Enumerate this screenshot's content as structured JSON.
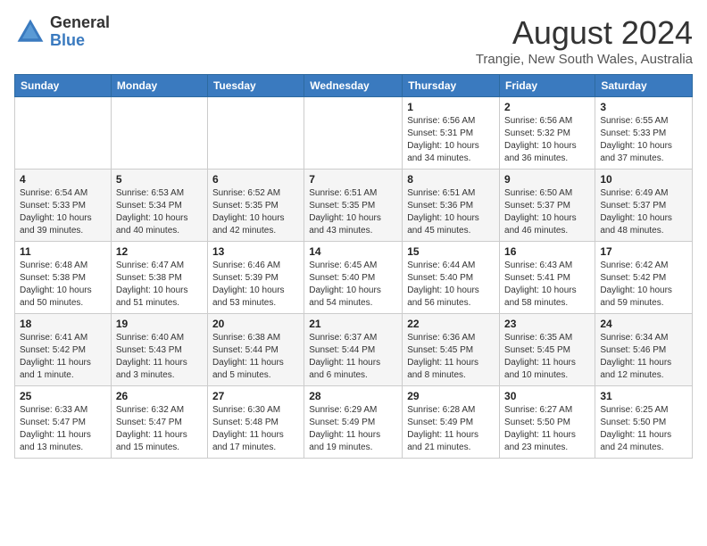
{
  "header": {
    "logo_general": "General",
    "logo_blue": "Blue",
    "main_title": "August 2024",
    "subtitle": "Trangie, New South Wales, Australia"
  },
  "calendar": {
    "weekdays": [
      "Sunday",
      "Monday",
      "Tuesday",
      "Wednesday",
      "Thursday",
      "Friday",
      "Saturday"
    ],
    "weeks": [
      [
        {
          "day": "",
          "info": ""
        },
        {
          "day": "",
          "info": ""
        },
        {
          "day": "",
          "info": ""
        },
        {
          "day": "",
          "info": ""
        },
        {
          "day": "1",
          "info": "Sunrise: 6:56 AM\nSunset: 5:31 PM\nDaylight: 10 hours\nand 34 minutes."
        },
        {
          "day": "2",
          "info": "Sunrise: 6:56 AM\nSunset: 5:32 PM\nDaylight: 10 hours\nand 36 minutes."
        },
        {
          "day": "3",
          "info": "Sunrise: 6:55 AM\nSunset: 5:33 PM\nDaylight: 10 hours\nand 37 minutes."
        }
      ],
      [
        {
          "day": "4",
          "info": "Sunrise: 6:54 AM\nSunset: 5:33 PM\nDaylight: 10 hours\nand 39 minutes."
        },
        {
          "day": "5",
          "info": "Sunrise: 6:53 AM\nSunset: 5:34 PM\nDaylight: 10 hours\nand 40 minutes."
        },
        {
          "day": "6",
          "info": "Sunrise: 6:52 AM\nSunset: 5:35 PM\nDaylight: 10 hours\nand 42 minutes."
        },
        {
          "day": "7",
          "info": "Sunrise: 6:51 AM\nSunset: 5:35 PM\nDaylight: 10 hours\nand 43 minutes."
        },
        {
          "day": "8",
          "info": "Sunrise: 6:51 AM\nSunset: 5:36 PM\nDaylight: 10 hours\nand 45 minutes."
        },
        {
          "day": "9",
          "info": "Sunrise: 6:50 AM\nSunset: 5:37 PM\nDaylight: 10 hours\nand 46 minutes."
        },
        {
          "day": "10",
          "info": "Sunrise: 6:49 AM\nSunset: 5:37 PM\nDaylight: 10 hours\nand 48 minutes."
        }
      ],
      [
        {
          "day": "11",
          "info": "Sunrise: 6:48 AM\nSunset: 5:38 PM\nDaylight: 10 hours\nand 50 minutes."
        },
        {
          "day": "12",
          "info": "Sunrise: 6:47 AM\nSunset: 5:38 PM\nDaylight: 10 hours\nand 51 minutes."
        },
        {
          "day": "13",
          "info": "Sunrise: 6:46 AM\nSunset: 5:39 PM\nDaylight: 10 hours\nand 53 minutes."
        },
        {
          "day": "14",
          "info": "Sunrise: 6:45 AM\nSunset: 5:40 PM\nDaylight: 10 hours\nand 54 minutes."
        },
        {
          "day": "15",
          "info": "Sunrise: 6:44 AM\nSunset: 5:40 PM\nDaylight: 10 hours\nand 56 minutes."
        },
        {
          "day": "16",
          "info": "Sunrise: 6:43 AM\nSunset: 5:41 PM\nDaylight: 10 hours\nand 58 minutes."
        },
        {
          "day": "17",
          "info": "Sunrise: 6:42 AM\nSunset: 5:42 PM\nDaylight: 10 hours\nand 59 minutes."
        }
      ],
      [
        {
          "day": "18",
          "info": "Sunrise: 6:41 AM\nSunset: 5:42 PM\nDaylight: 11 hours\nand 1 minute."
        },
        {
          "day": "19",
          "info": "Sunrise: 6:40 AM\nSunset: 5:43 PM\nDaylight: 11 hours\nand 3 minutes."
        },
        {
          "day": "20",
          "info": "Sunrise: 6:38 AM\nSunset: 5:44 PM\nDaylight: 11 hours\nand 5 minutes."
        },
        {
          "day": "21",
          "info": "Sunrise: 6:37 AM\nSunset: 5:44 PM\nDaylight: 11 hours\nand 6 minutes."
        },
        {
          "day": "22",
          "info": "Sunrise: 6:36 AM\nSunset: 5:45 PM\nDaylight: 11 hours\nand 8 minutes."
        },
        {
          "day": "23",
          "info": "Sunrise: 6:35 AM\nSunset: 5:45 PM\nDaylight: 11 hours\nand 10 minutes."
        },
        {
          "day": "24",
          "info": "Sunrise: 6:34 AM\nSunset: 5:46 PM\nDaylight: 11 hours\nand 12 minutes."
        }
      ],
      [
        {
          "day": "25",
          "info": "Sunrise: 6:33 AM\nSunset: 5:47 PM\nDaylight: 11 hours\nand 13 minutes."
        },
        {
          "day": "26",
          "info": "Sunrise: 6:32 AM\nSunset: 5:47 PM\nDaylight: 11 hours\nand 15 minutes."
        },
        {
          "day": "27",
          "info": "Sunrise: 6:30 AM\nSunset: 5:48 PM\nDaylight: 11 hours\nand 17 minutes."
        },
        {
          "day": "28",
          "info": "Sunrise: 6:29 AM\nSunset: 5:49 PM\nDaylight: 11 hours\nand 19 minutes."
        },
        {
          "day": "29",
          "info": "Sunrise: 6:28 AM\nSunset: 5:49 PM\nDaylight: 11 hours\nand 21 minutes."
        },
        {
          "day": "30",
          "info": "Sunrise: 6:27 AM\nSunset: 5:50 PM\nDaylight: 11 hours\nand 23 minutes."
        },
        {
          "day": "31",
          "info": "Sunrise: 6:25 AM\nSunset: 5:50 PM\nDaylight: 11 hours\nand 24 minutes."
        }
      ]
    ]
  }
}
